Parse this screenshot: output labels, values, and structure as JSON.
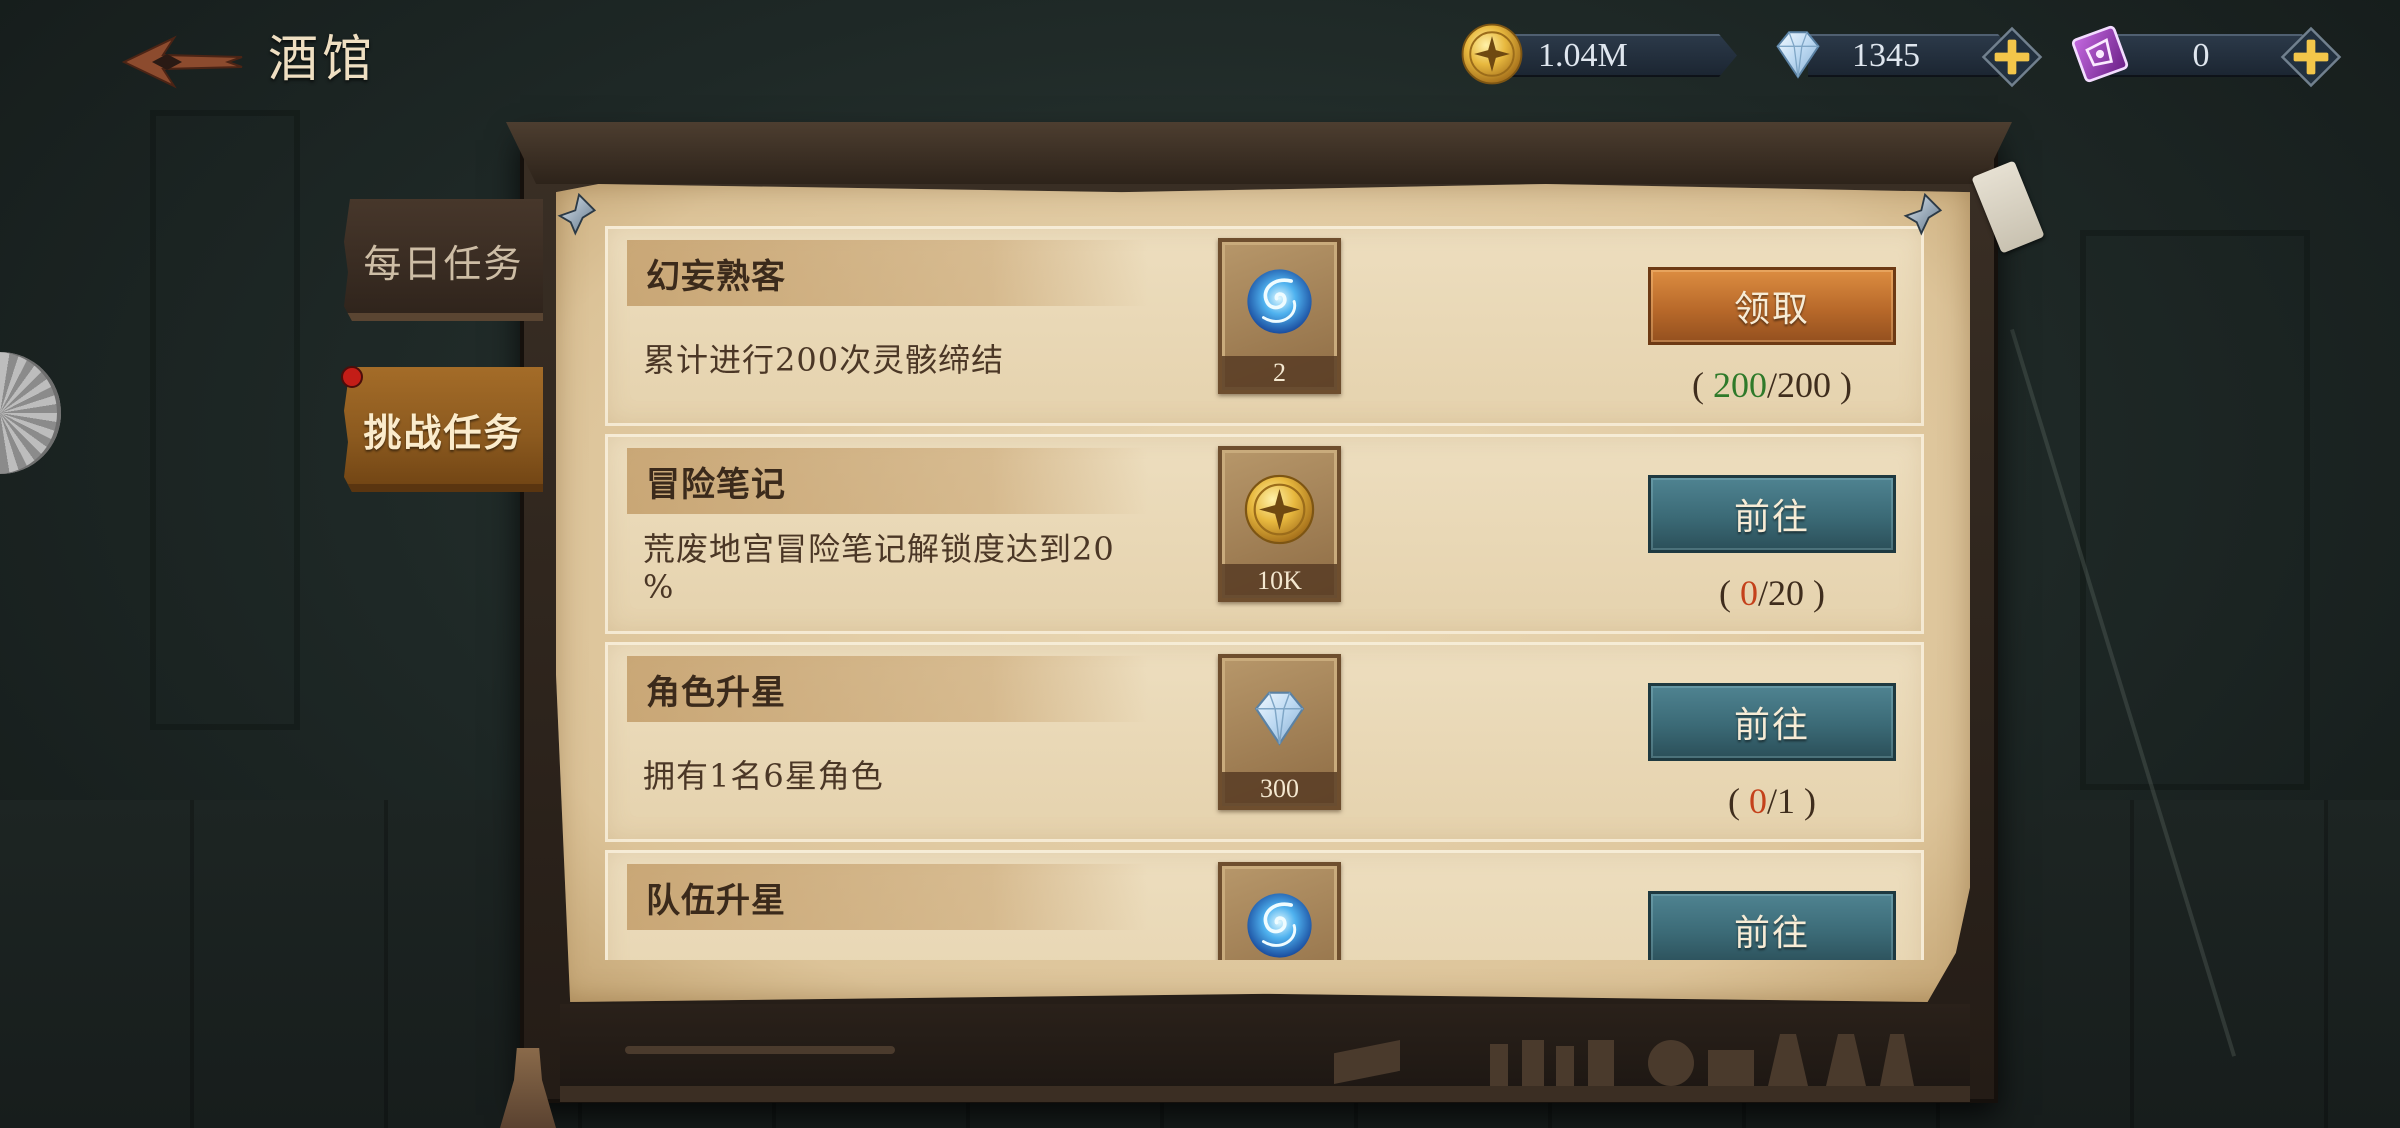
{
  "header": {
    "title": "酒馆",
    "back_icon": "back-arrow-icon"
  },
  "currencies": [
    {
      "icon": "gold-coin-icon",
      "value": "1.04M",
      "has_add_button": false
    },
    {
      "icon": "diamond-icon",
      "value": "1345",
      "has_add_button": true
    },
    {
      "icon": "purple-ticket-icon",
      "value": "0",
      "has_add_button": true
    }
  ],
  "tabs": [
    {
      "label": "每日任务",
      "selected": false,
      "has_badge": false
    },
    {
      "label": "挑战任务",
      "selected": true,
      "has_badge": true
    }
  ],
  "tasks": [
    {
      "title": "幻妄熟客",
      "description": "累计进行200次灵骸缔结",
      "reward": {
        "icon": "blue-spirit-icon",
        "amount": "2"
      },
      "button_label": "领取",
      "claimable": true,
      "progress": {
        "current": 200,
        "target": 200
      }
    },
    {
      "title": "冒险笔记",
      "description": "荒废地宫冒险笔记解锁度达到20%",
      "reward": {
        "icon": "gold-coin-icon",
        "amount": "10K"
      },
      "button_label": "前往",
      "claimable": false,
      "progress": {
        "current": 0,
        "target": 20
      }
    },
    {
      "title": "角色升星",
      "description": "拥有1名6星角色",
      "reward": {
        "icon": "diamond-icon",
        "amount": "300"
      },
      "button_label": "前往",
      "claimable": false,
      "progress": {
        "current": 0,
        "target": 1
      }
    },
    {
      "title": "队伍升星",
      "reward": {
        "icon": "blue-spirit-icon"
      },
      "button_label": "前往",
      "claimable": false
    }
  ],
  "colors": {
    "progress_complete": "#2f7a2a",
    "progress_incomplete": "#c4411b",
    "claim_button": "#b8692a",
    "go_button": "#3b6a76",
    "selected_tab": "#8c5a1f",
    "badge": "#c41d17"
  }
}
